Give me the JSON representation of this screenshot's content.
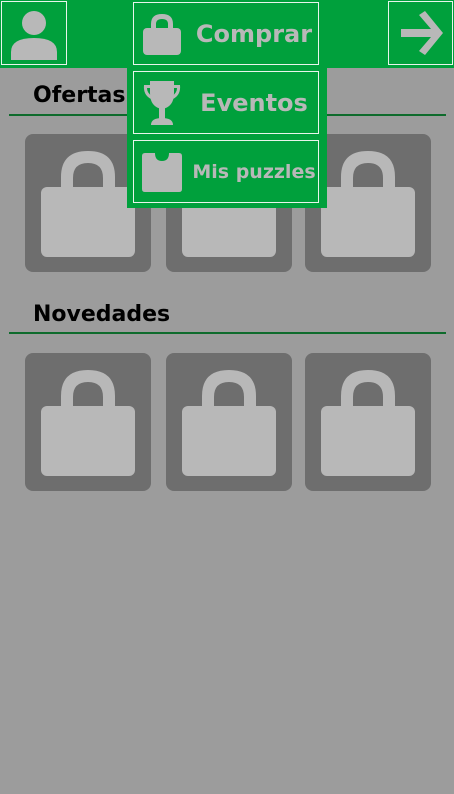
{
  "topbar": {
    "profile_icon": "person-icon",
    "next_icon": "arrow-right-icon"
  },
  "menu": {
    "items": [
      {
        "label": "Comprar",
        "icon": "padlock-icon"
      },
      {
        "label": "Eventos",
        "icon": "trophy-icon"
      },
      {
        "label": "Mis puzzles",
        "icon": "bag-icon"
      }
    ]
  },
  "sections": [
    {
      "title": "Ofertas",
      "tiles": [
        {
          "state": "locked"
        },
        {
          "state": "locked"
        },
        {
          "state": "locked"
        }
      ]
    },
    {
      "title": "Novedades",
      "tiles": [
        {
          "state": "locked"
        },
        {
          "state": "locked"
        },
        {
          "state": "locked"
        }
      ]
    }
  ],
  "colors": {
    "background": "#9c9c9c",
    "brand_green": "#00a03c",
    "tile": "#6e6e6e",
    "icon_gray": "#b8b8b8",
    "divider": "#0e6b2c"
  }
}
